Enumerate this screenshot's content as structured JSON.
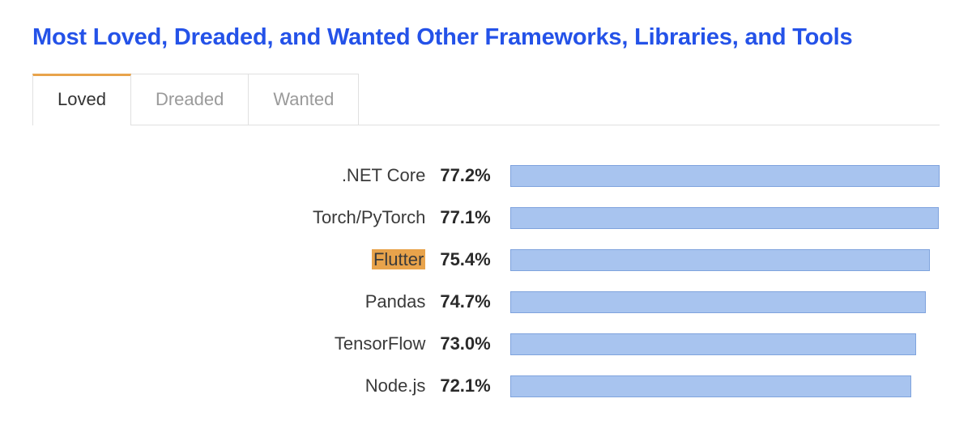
{
  "title": "Most Loved, Dreaded, and Wanted Other Frameworks, Libraries, and Tools",
  "tabs": [
    {
      "label": "Loved",
      "active": true
    },
    {
      "label": "Dreaded",
      "active": false
    },
    {
      "label": "Wanted",
      "active": false
    }
  ],
  "chart_data": {
    "type": "bar",
    "orientation": "horizontal",
    "title": "Most Loved, Dreaded, and Wanted Other Frameworks, Libraries, and Tools",
    "xlabel": "",
    "ylabel": "",
    "xlim": [
      0,
      100
    ],
    "highlight": "Flutter",
    "categories": [
      ".NET Core",
      "Torch/PyTorch",
      "Flutter",
      "Pandas",
      "TensorFlow",
      "Node.js"
    ],
    "values": [
      77.2,
      77.1,
      75.4,
      74.7,
      73.0,
      72.1
    ],
    "value_labels": [
      "77.2%",
      "77.1%",
      "75.4%",
      "74.7%",
      "73.0%",
      "72.1%"
    ]
  }
}
